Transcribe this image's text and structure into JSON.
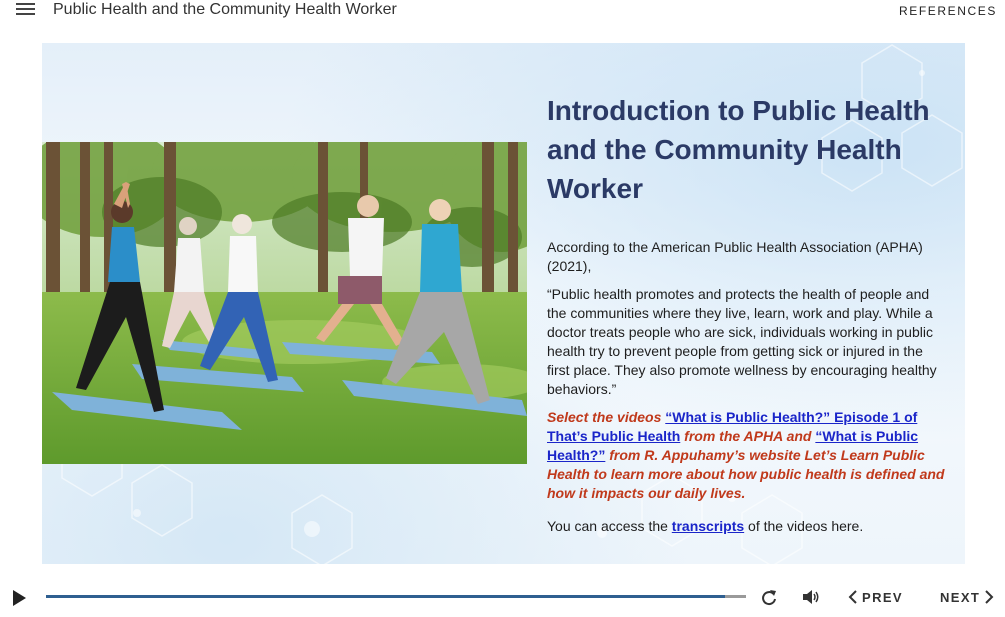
{
  "header": {
    "course_title": "Public Health and the Community Health Worker",
    "references_label": "REFERENCES",
    "menu_icon": "hamburger-menu-icon"
  },
  "slide": {
    "title": "Introduction to Public Health and the Community Health Worker",
    "photo_description_icon": "group-yoga-photo",
    "para1": "According to the American Public Health Association (APHA) (2021),",
    "quote": "“Public health promotes and protects the health of people and the communities where they live, learn, work and play. While a doctor treats people who are sick, individuals working in public health try to prevent people from getting sick or injured in the first place. They also promote wellness by encouraging healthy behaviors.”",
    "callout": {
      "part1": "Select the videos ",
      "link1": "“What is Public Health?” Episode 1 of That’s Public Health",
      "part2": " from the APHA and ",
      "link2": "“What is Public Health?”",
      "part3": " from R. Appuhamy’s website Let’s Learn Public Health to learn more about how public health is defined and how it impacts our daily lives."
    },
    "transcripts": {
      "before": "You can access the ",
      "link": "transcripts",
      "after": " of the videos here."
    },
    "colors": {
      "title": "#2b3a66",
      "callout": "#c0391b",
      "link": "#1a25c9"
    }
  },
  "player": {
    "progress": 0.97,
    "prev_label": "PREV",
    "next_label": "NEXT",
    "icons": [
      "play-icon",
      "replay-icon",
      "volume-icon",
      "chevron-left-icon",
      "chevron-right-icon"
    ],
    "accent": "#2e5f90"
  }
}
